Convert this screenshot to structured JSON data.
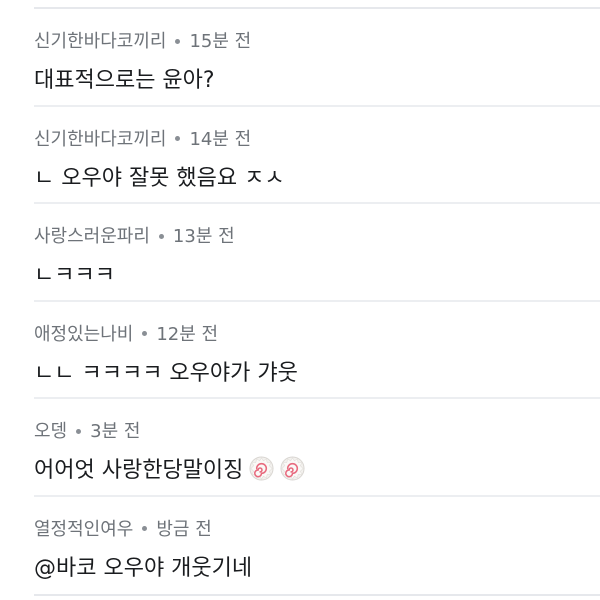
{
  "comments": [
    {
      "author": "신기한바다코끼리",
      "time": "15분 전",
      "text": "대표적으로는 윤아?",
      "emoji": []
    },
    {
      "author": "신기한바다코끼리",
      "time": "14분 전",
      "text": "ㄴ 오우야 잘못 했음요 ㅈㅅ",
      "emoji": []
    },
    {
      "author": "사랑스러운파리",
      "time": "13분 전",
      "text": "ㄴㅋㅋㅋ",
      "emoji": []
    },
    {
      "author": "애정있는나비",
      "time": "12분 전",
      "text": "ㄴㄴ ㅋㅋㅋㅋ 오우야가 갸웃",
      "emoji": []
    },
    {
      "author": "오뎅",
      "time": "3분 전",
      "text": "어어엇 사랑한당말이징",
      "emoji": [
        "fishcake-icon",
        "fishcake-icon"
      ]
    },
    {
      "author": "열정적인여우",
      "time": "방금 전",
      "text": "@바코 오우야 개웃기네",
      "emoji": []
    }
  ]
}
